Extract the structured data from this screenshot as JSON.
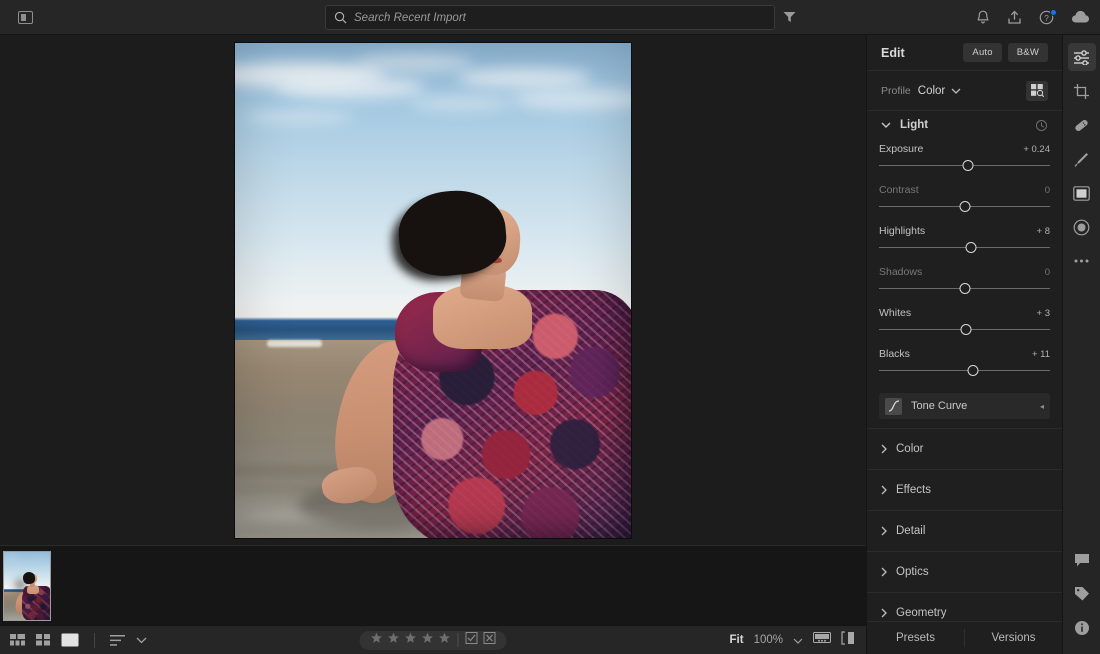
{
  "topbar": {
    "panel_toggle_icon": "panel-layout-icon",
    "search": {
      "placeholder": "Search Recent Import",
      "value": "",
      "icon": "search-icon"
    },
    "filter_icon": "filter-funnel-icon",
    "right_icons": [
      {
        "name": "notification-bell-icon",
        "label": "Notifications"
      },
      {
        "name": "share-icon",
        "label": "Share"
      },
      {
        "name": "help-icon",
        "label": "Help",
        "badge": true
      },
      {
        "name": "cloud-sync-icon",
        "label": "Cloud"
      }
    ]
  },
  "viewer": {
    "photo_alt": "Woman in paisley dress sitting on beach sand",
    "filmstrip": [
      {
        "name": "filmstrip-thumb-1",
        "selected": true
      }
    ]
  },
  "bottombar": {
    "view_grid_icon": "grid-view-icon",
    "view_square_icon": "square-grid-icon",
    "view_detail_icon": "detail-view-icon",
    "sort_icon": "sort-icon",
    "sort_chevron_icon": "chevron-down-icon",
    "rating": {
      "stars": 5,
      "filled": 0,
      "flag_pick_icon": "flag-pick-icon",
      "flag_reject_icon": "flag-reject-icon"
    },
    "zoom": {
      "fit_label": "Fit",
      "percent_label": "100%",
      "chevron_icon": "chevron-down-icon"
    },
    "filmstrip_toggle_icon": "filmstrip-toggle-icon",
    "compare_icon": "before-after-icon"
  },
  "edit_panel": {
    "title": "Edit",
    "auto_label": "Auto",
    "bw_label": "B&W",
    "profile": {
      "label": "Profile",
      "value": "Color",
      "chevron_icon": "chevron-down-icon",
      "browser_icon": "profile-browser-icon"
    },
    "light": {
      "name": "Light",
      "expanded": true,
      "chevron_icon": "chevron-down-icon",
      "eye_icon": "visibility-toggle-icon",
      "sliders": [
        {
          "name": "Exposure",
          "value": "+ 0.24",
          "pos": 52,
          "dim": false
        },
        {
          "name": "Contrast",
          "value": "0",
          "pos": 50,
          "dim": true
        },
        {
          "name": "Highlights",
          "value": "+ 8",
          "pos": 54,
          "dim": false
        },
        {
          "name": "Shadows",
          "value": "0",
          "pos": 50,
          "dim": true
        },
        {
          "name": "Whites",
          "value": "+ 3",
          "pos": 51,
          "dim": false
        },
        {
          "name": "Blacks",
          "value": "+ 11",
          "pos": 55,
          "dim": false
        }
      ]
    },
    "tone_curve": {
      "label": "Tone Curve",
      "icon": "tone-curve-icon",
      "arrow": "◂"
    },
    "sections": [
      {
        "name": "Color",
        "chevron_icon": "chevron-right-icon"
      },
      {
        "name": "Effects",
        "chevron_icon": "chevron-right-icon"
      },
      {
        "name": "Detail",
        "chevron_icon": "chevron-right-icon"
      },
      {
        "name": "Optics",
        "chevron_icon": "chevron-right-icon"
      },
      {
        "name": "Geometry",
        "chevron_icon": "chevron-right-icon"
      }
    ],
    "footer": {
      "presets_label": "Presets",
      "versions_label": "Versions"
    }
  },
  "rail": {
    "top_items": [
      {
        "name": "edit-sliders-icon",
        "active": true
      },
      {
        "name": "crop-icon",
        "active": false
      },
      {
        "name": "healing-brush-icon",
        "active": false
      },
      {
        "name": "brush-icon",
        "active": false
      },
      {
        "name": "masking-icon",
        "active": false
      },
      {
        "name": "radial-gradient-icon",
        "active": false
      },
      {
        "name": "more-options-icon",
        "active": false
      }
    ],
    "bottom_items": [
      {
        "name": "comments-icon"
      },
      {
        "name": "keyword-tag-icon"
      },
      {
        "name": "info-icon"
      }
    ]
  },
  "colors": {
    "app_bg": "#1c1c1c",
    "chrome": "#262626",
    "panel": "#1f1f1f",
    "accent": "#1473e6",
    "text": "#d4d4d4"
  }
}
